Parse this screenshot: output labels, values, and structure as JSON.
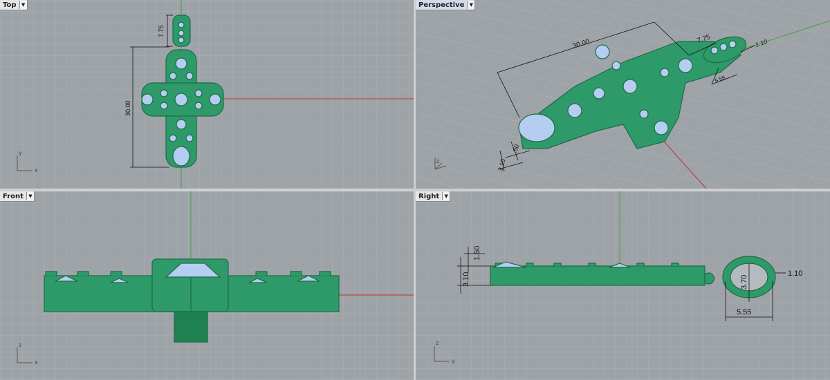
{
  "viewports": {
    "top": {
      "label": "Top",
      "dims": {
        "bail_height": "7.75",
        "cross_height": "30.00"
      }
    },
    "perspective": {
      "label": "Perspective",
      "dims": {
        "cross_height": "30.00",
        "bail_height": "7.75",
        "bail_thickness": "1.10",
        "bail_width": "5.55",
        "stone_height": ".50",
        "stone_thickness": "3.10"
      }
    },
    "front": {
      "label": "Front"
    },
    "right": {
      "label": "Right",
      "dims": {
        "height_a": "1.50",
        "height_b": "3.10",
        "bail_inner": "3.70",
        "bail_thickness": "1.10",
        "bail_width": "5.55"
      }
    }
  },
  "axis_labels": {
    "x": "x",
    "y": "y",
    "z": "z"
  },
  "colors": {
    "viewport_bg": "#9ea3a8",
    "grid": "#b2b6ba",
    "model_green": "#2e9a6a",
    "model_dark": "#1e7a50",
    "stone_blue": "#b4cdf0",
    "x_axis": "#c03030",
    "y_axis": "#40a040"
  }
}
